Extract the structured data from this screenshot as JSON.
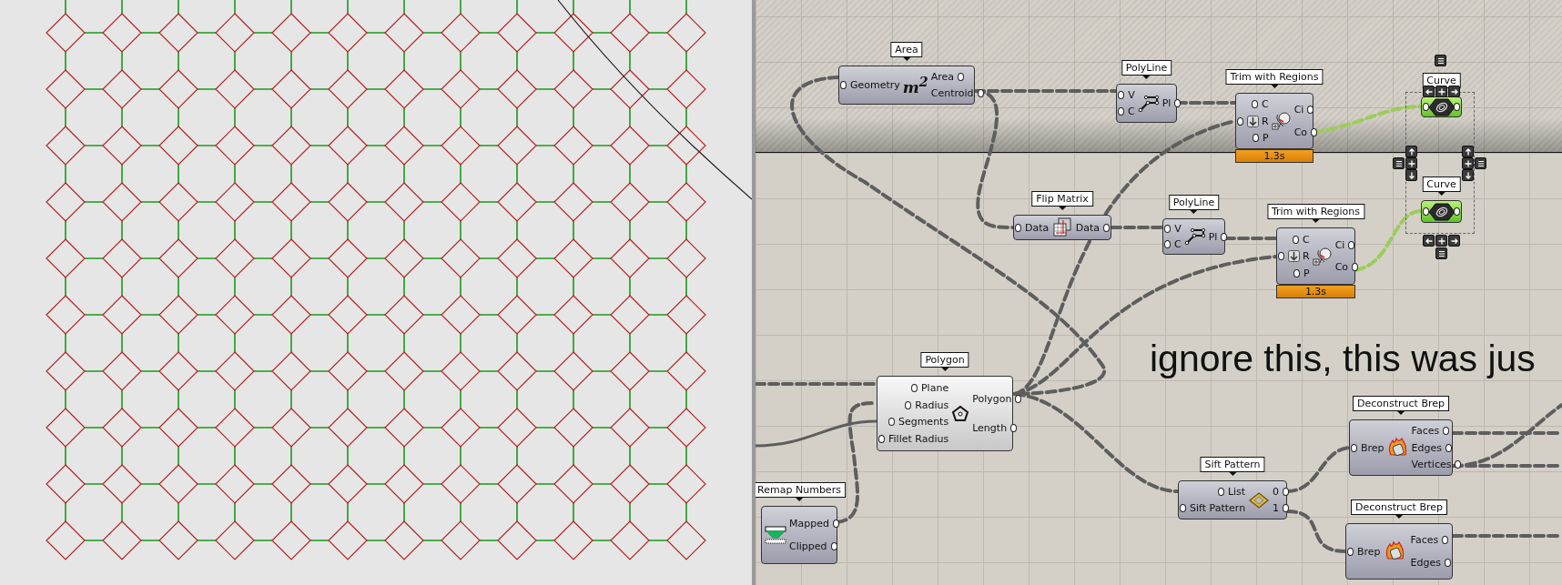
{
  "canvas": {
    "nodes": [
      {
        "kind": "component",
        "label": "Area",
        "inputs": [
          "Geometry"
        ],
        "outputs": [
          "Area",
          "Centroid"
        ],
        "icon_text": "m$^{2}$"
      },
      {
        "kind": "component",
        "label": "PolyLine",
        "inputs": [
          "V",
          "C"
        ],
        "outputs": [
          "Pl"
        ]
      },
      {
        "kind": "component",
        "label": "Trim with Regions",
        "inputs": [
          "C",
          "R",
          "P"
        ],
        "outputs": [
          "Ci",
          "Co"
        ],
        "timing": "1.3s"
      },
      {
        "kind": "param",
        "label": "Curve"
      },
      {
        "kind": "param",
        "label": "Curve"
      },
      {
        "kind": "component",
        "label": "Flip Matrix",
        "inputs": [
          "Data"
        ],
        "outputs": [
          "Data"
        ]
      },
      {
        "kind": "component",
        "label": "PolyLine",
        "inputs": [
          "V",
          "C"
        ],
        "outputs": [
          "Pl"
        ]
      },
      {
        "kind": "component",
        "label": "Trim with Regions",
        "inputs": [
          "C",
          "R",
          "P"
        ],
        "outputs": [
          "Ci",
          "Co"
        ],
        "timing": "1.3s"
      },
      {
        "kind": "light",
        "label": "Polygon",
        "inputs": [
          "Plane",
          "Radius",
          "Segments",
          "Fillet Radius"
        ],
        "outputs": [
          "Polygon",
          "Length"
        ]
      },
      {
        "kind": "component",
        "label": "Remap Numbers",
        "outputs": [
          "Mapped",
          "Clipped"
        ]
      },
      {
        "kind": "component",
        "label": "Sift Pattern",
        "inputs": [
          "List",
          "Sift Pattern"
        ],
        "outputs": [
          "0",
          "1"
        ]
      },
      {
        "kind": "component",
        "label": "Deconstruct Brep",
        "inputs": [
          "Brep"
        ],
        "outputs": [
          "Faces",
          "Edges",
          "Vertices"
        ]
      },
      {
        "kind": "component",
        "label": "Deconstruct Brep",
        "inputs": [
          "Brep"
        ],
        "outputs": [
          "Faces",
          "Edges"
        ]
      }
    ],
    "overlay_text": "ignore this, this was jus"
  }
}
